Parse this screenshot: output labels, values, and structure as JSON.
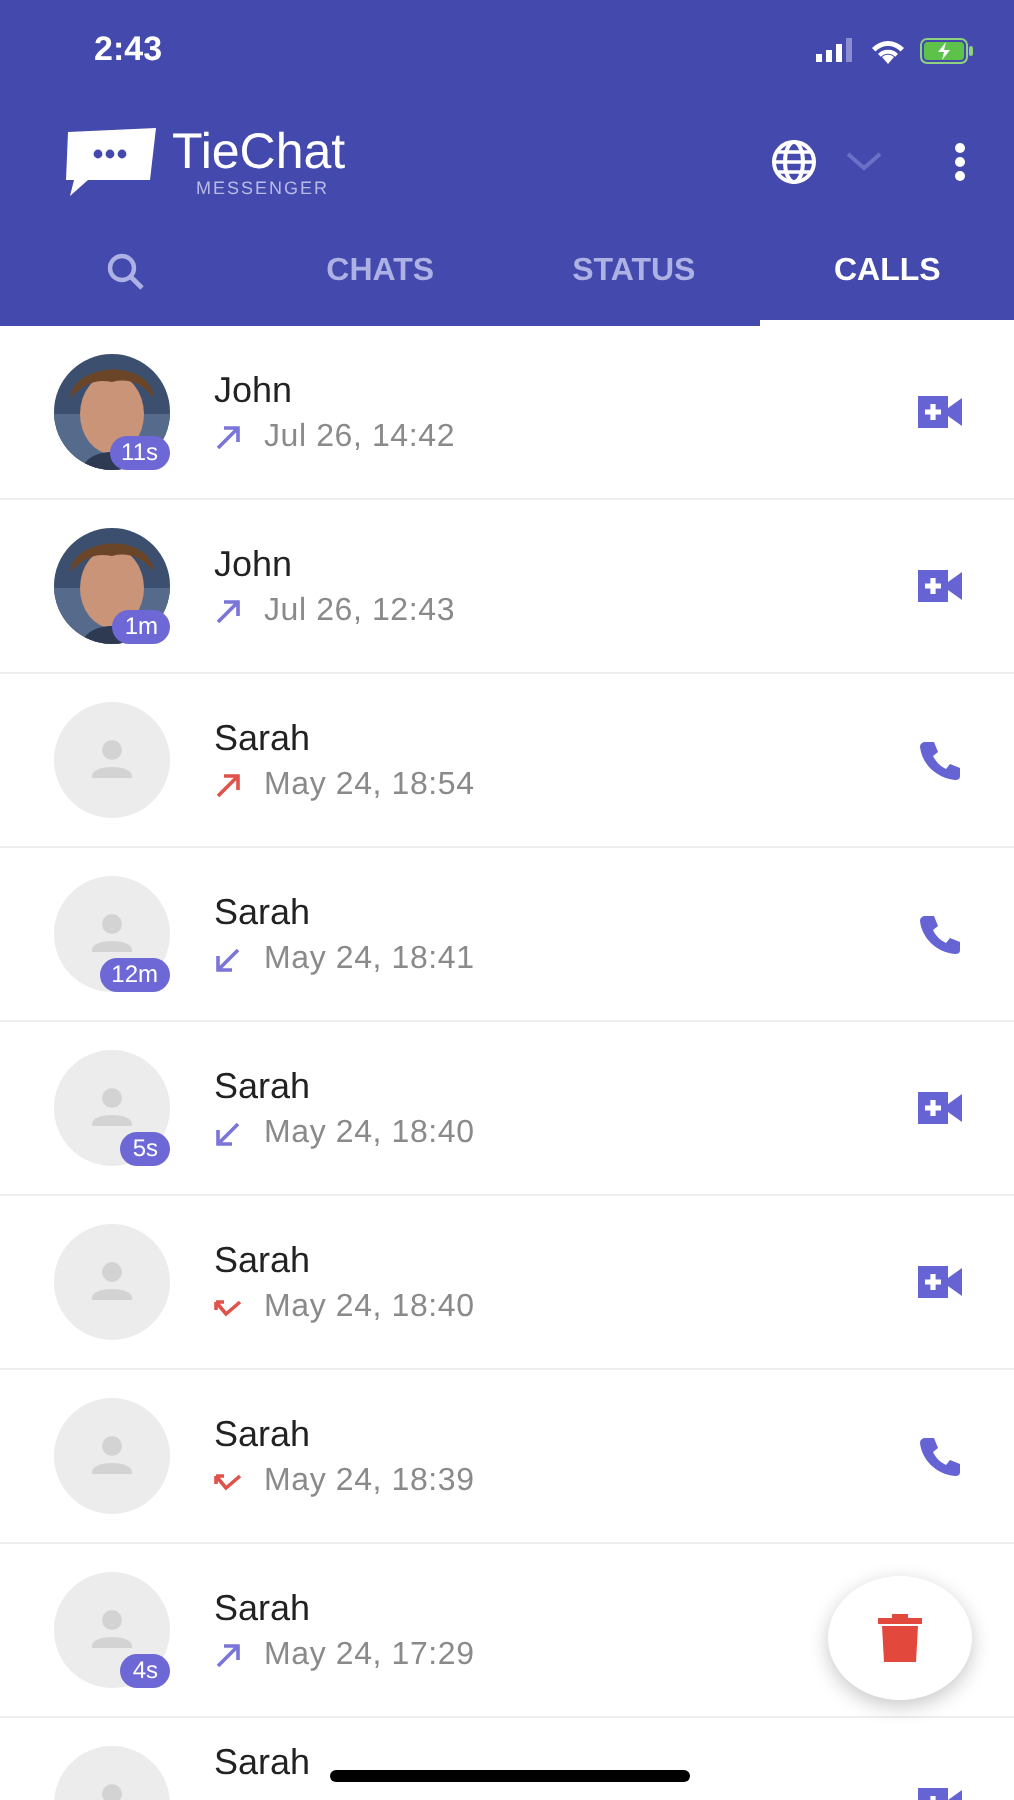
{
  "status_bar": {
    "time": "2:43"
  },
  "app_bar": {
    "title": "TieChat",
    "subtitle": "MESSENGER"
  },
  "tabs": [
    {
      "kind": "search",
      "selected": false
    },
    {
      "kind": "label",
      "label": "CHATS",
      "selected": false
    },
    {
      "kind": "label",
      "label": "STATUS",
      "selected": false
    },
    {
      "kind": "label",
      "label": "CALLS",
      "selected": true
    }
  ],
  "calls": [
    {
      "name": "John",
      "has_photo": true,
      "duration": "11s",
      "kind": "outgoing",
      "color": "#7b74d9",
      "time": "Jul 26, 14:42",
      "video": true
    },
    {
      "name": "John",
      "has_photo": true,
      "duration": "1m",
      "kind": "outgoing",
      "color": "#7b74d9",
      "time": "Jul 26, 12:43",
      "video": true
    },
    {
      "name": "Sarah",
      "has_photo": false,
      "kind": "outgoing",
      "color": "#e0524a",
      "time": "May 24, 18:54",
      "video": false
    },
    {
      "name": "Sarah",
      "has_photo": false,
      "duration": "12m",
      "kind": "incoming",
      "color": "#7b74d9",
      "time": "May 24, 18:41",
      "video": false
    },
    {
      "name": "Sarah",
      "has_photo": false,
      "duration": "5s",
      "kind": "incoming",
      "color": "#7b74d9",
      "time": "May 24, 18:40",
      "video": true
    },
    {
      "name": "Sarah",
      "has_photo": false,
      "kind": "missed",
      "color": "#e0524a",
      "time": "May 24, 18:40",
      "video": true
    },
    {
      "name": "Sarah",
      "has_photo": false,
      "kind": "missed",
      "color": "#e0524a",
      "time": "May 24, 18:39",
      "video": false
    },
    {
      "name": "Sarah",
      "has_photo": false,
      "duration": "4s",
      "kind": "outgoing",
      "color": "#7b74d9",
      "time": "May 24, 17:29"
    },
    {
      "name": "Sarah",
      "has_photo": false,
      "video": true
    }
  ],
  "fab": {
    "kind": "delete"
  }
}
